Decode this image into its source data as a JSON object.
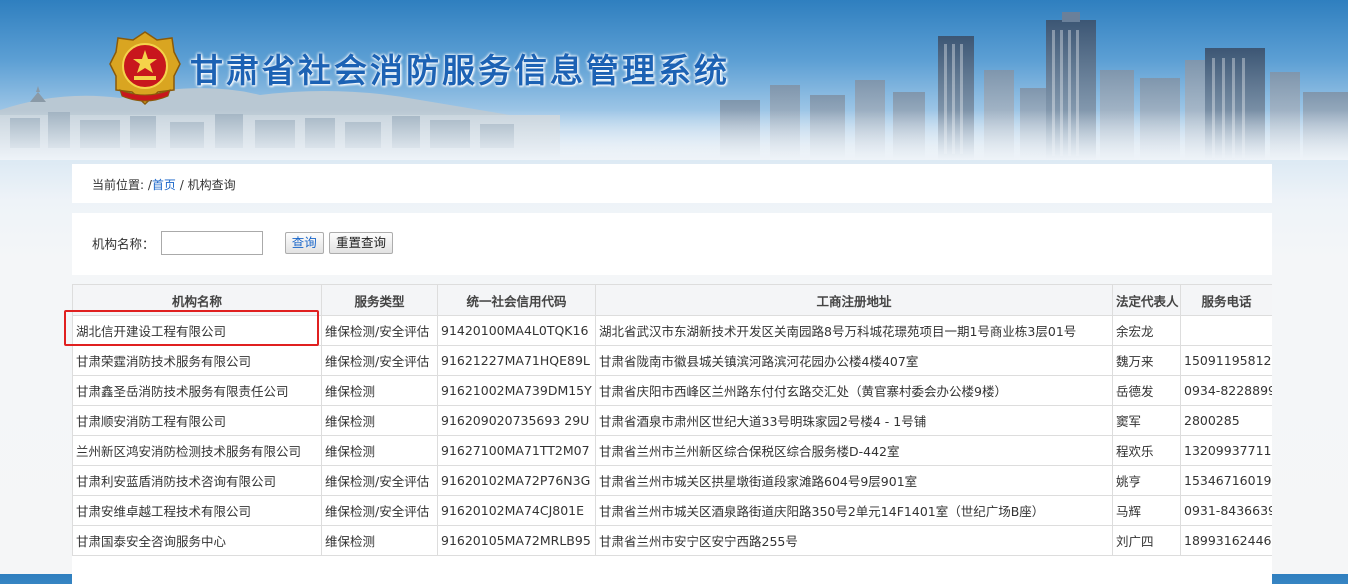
{
  "header": {
    "title": "甘肃省社会消防服务信息管理系统",
    "emblem_icon": "fire-rescue-emblem-icon"
  },
  "breadcrumb": {
    "prefix": "当前位置: /",
    "home": "首页",
    "separator": " / ",
    "current": "机构查询"
  },
  "search": {
    "label": "机构名称：",
    "input_value": "",
    "query_button": "查询",
    "reset_button": "重置查询"
  },
  "table": {
    "columns": [
      "机构名称",
      "服务类型",
      "统一社会信用代码",
      "工商注册地址",
      "法定代表人",
      "服务电话"
    ],
    "rows": [
      [
        "湖北信开建设工程有限公司",
        "维保检测/安全评估",
        "91420100MA4L0TQK16",
        "湖北省武汉市东湖新技术开发区关南园路8号万科城花璟苑项目一期1号商业栋3层01号",
        "余宏龙",
        ""
      ],
      [
        "甘肃荣霆消防技术服务有限公司",
        "维保检测/安全评估",
        "91621227MA71HQE89L",
        "甘肃省陇南市徽县城关镇滨河路滨河花园办公楼4楼407室",
        "魏万来",
        "15091195812"
      ],
      [
        "甘肃鑫圣岳消防技术服务有限责任公司",
        "维保检测",
        "91621002MA739DM15Y",
        "甘肃省庆阳市西峰区兰州路东付付玄路交汇处（黄官寨村委会办公楼9楼）",
        "岳德发",
        "0934-8228899"
      ],
      [
        "甘肃顺安消防工程有限公司",
        "维保检测",
        "916209020735693 29U",
        "甘肃省酒泉市肃州区世纪大道33号明珠家园2号楼4 - 1号铺",
        "窦军",
        "2800285"
      ],
      [
        "兰州新区鸿安消防检测技术服务有限公司",
        "维保检测",
        "91627100MA71TT2M07",
        "甘肃省兰州市兰州新区综合保税区综合服务楼D-442室",
        "程欢乐",
        "13209937711"
      ],
      [
        "甘肃利安蓝盾消防技术咨询有限公司",
        "维保检测/安全评估",
        "91620102MA72P76N3G",
        "甘肃省兰州市城关区拱星墩街道段家滩路604号9层901室",
        "姚亨",
        "15346716019"
      ],
      [
        "甘肃安维卓越工程技术有限公司",
        "维保检测/安全评估",
        "91620102MA74CJ801E",
        "甘肃省兰州市城关区酒泉路街道庆阳路350号2单元14F1401室（世纪广场B座）",
        "马辉",
        "0931-8436639"
      ],
      [
        "甘肃国泰安全咨询服务中心",
        "维保检测",
        "91620105MA72MRLB95",
        "甘肃省兰州市安宁区安宁西路255号",
        "刘广四",
        "18993162446"
      ]
    ]
  },
  "colors": {
    "title_blue": "#1c62b4",
    "link_blue": "#1a66c9",
    "highlight_red": "#e02020"
  }
}
